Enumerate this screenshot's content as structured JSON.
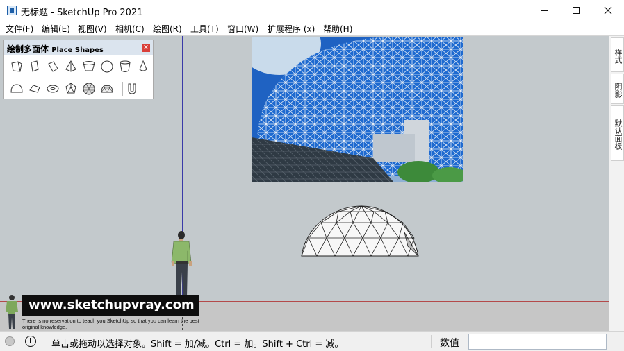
{
  "window": {
    "title": "无标题 - SketchUp Pro 2021",
    "app_icon": "sketchup-icon",
    "controls": [
      "minimize-icon",
      "maximize-icon",
      "close-icon"
    ]
  },
  "menu": {
    "items": [
      "文件(F)",
      "编辑(E)",
      "视图(V)",
      "相机(C)",
      "绘图(R)",
      "工具(T)",
      "窗口(W)",
      "扩展程序 (x)",
      "帮助(H)"
    ]
  },
  "toolbar": {
    "title_cn": "绘制多面体",
    "title_en": "Place Shapes",
    "close": "×",
    "icons": [
      "cube-icon",
      "prism-icon",
      "octahedron-icon",
      "pyramid-icon",
      "frustum-icon",
      "sphere-icon",
      "cylinder-icon",
      "cone-icon",
      "dome-icon",
      "cushion-icon",
      "torus-icon",
      "dodecahedron-icon",
      "geosphere-icon",
      "geodome-icon",
      "magnet-icon"
    ]
  },
  "tray": {
    "tabs": [
      "样式",
      "阴影",
      "默认面板"
    ]
  },
  "viewport": {
    "watermark_url": "www.sketchupvray.com",
    "watermark_note": "There is no reservation to teach you SketchUp so that you can learn the best original knowledge."
  },
  "statusbar": {
    "geo_icon": "geolocation-icon",
    "info_icon": "i",
    "hint": "单击或拖动以选择对象。Shift = 加/减。Ctrl = 加。Shift + Ctrl = 减。",
    "measurements_label": "数值",
    "measurements_value": ""
  },
  "colors": {
    "viewport_bg": "#c3c9cc",
    "axis_red": "#b44a4a",
    "axis_blue": "#3a3aa8",
    "toolbar_title_bg": "#dbe4ee",
    "close_red": "#d9403a"
  }
}
